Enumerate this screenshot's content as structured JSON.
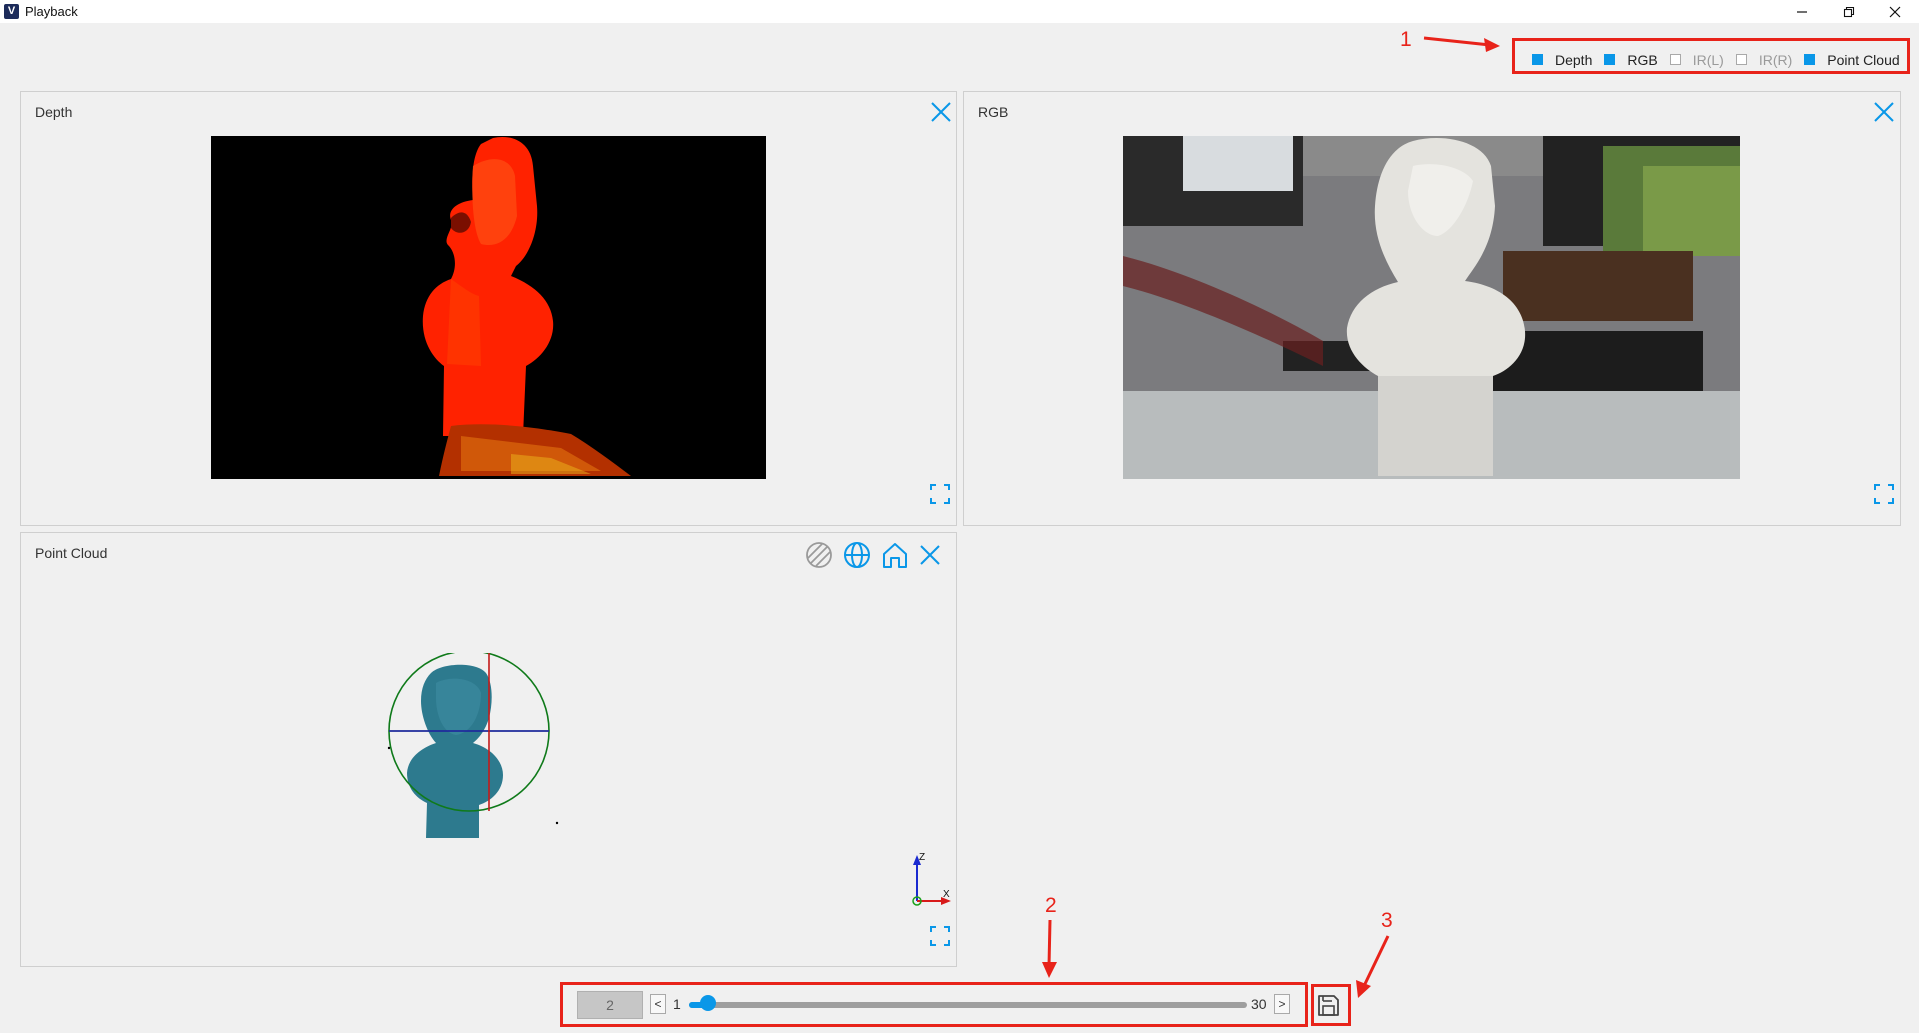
{
  "window": {
    "title": "Playback",
    "app_icon_letter": "V",
    "minimize_icon": "minimize-icon",
    "restore_icon": "restore-icon",
    "close_icon": "close-icon"
  },
  "streams": [
    {
      "label": "Depth",
      "checked": true
    },
    {
      "label": "RGB",
      "checked": true
    },
    {
      "label": "IR(L)",
      "checked": false
    },
    {
      "label": "IR(R)",
      "checked": false
    },
    {
      "label": "Point Cloud",
      "checked": true
    }
  ],
  "annotations": {
    "n1": "1",
    "n2": "2",
    "n3": "3"
  },
  "panels": {
    "depth": {
      "title": "Depth"
    },
    "rgb": {
      "title": "RGB"
    },
    "point_cloud": {
      "title": "Point Cloud",
      "toolbar_icons": [
        "hatch-icon",
        "globe-icon",
        "home-icon",
        "close-icon"
      ],
      "axis_z": "Z",
      "axis_x": "X"
    }
  },
  "playback": {
    "current_frame": "2",
    "min_label": "1",
    "max_label": "30",
    "prev_label": "<",
    "next_label": ">",
    "progress_fraction": 0.034,
    "save_icon": "save-icon"
  },
  "colors": {
    "accent": "#0a97e8",
    "annotation": "#e8231a"
  }
}
